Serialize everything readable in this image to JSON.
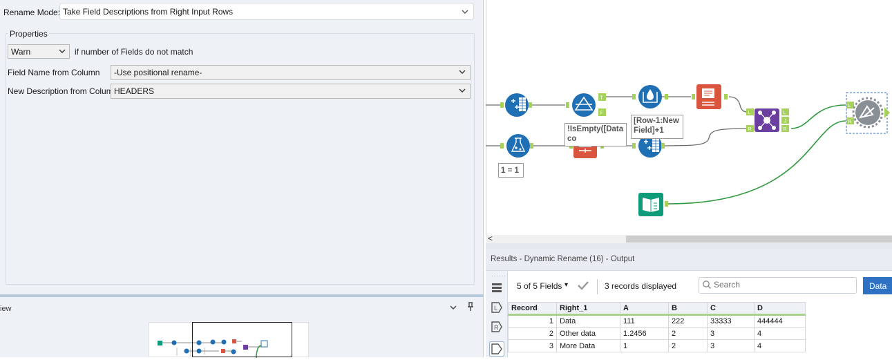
{
  "config": {
    "rename_mode_label": "Rename Mode:",
    "rename_mode_value": "Take Field Descriptions from Right Input Rows",
    "properties_label": "Properties",
    "warn_value": "Warn",
    "warn_suffix": "if number of Fields do not match",
    "field_name_label": "Field Name from Column",
    "field_name_value": "-Use positional rename-",
    "new_desc_label": "New Description from Column",
    "new_desc_value": "HEADERS"
  },
  "overview": {
    "title": "iew"
  },
  "canvas": {
    "annotations": {
      "filter": "!IsEmpty([Data co",
      "formula": "[Row-1:New Field]+1",
      "generate_rows": "1 = 1"
    },
    "anchors": {
      "true": "T",
      "false": "F",
      "left": "L",
      "right": "R",
      "join": "J"
    },
    "scroll_left_glyph": "<"
  },
  "results": {
    "title": "Results - Dynamic Rename (16) - Output",
    "fields_count": "5 of 5 Fields",
    "records_displayed": "3 records displayed",
    "search_placeholder": "Search",
    "data_button": "Data",
    "columns": [
      "Record",
      "Right_1",
      "A",
      "B",
      "C",
      "D"
    ],
    "rows": [
      [
        "1",
        "Data",
        "111",
        "222",
        "33333",
        "444444"
      ],
      [
        "2",
        "Other data",
        "1.2456",
        "2",
        "3",
        "4"
      ],
      [
        "3",
        "More Data",
        "1",
        "2",
        "3",
        "4"
      ]
    ]
  },
  "colors": {
    "accent_blue": "#2f72c4",
    "tool_blue": "#1f6fb5",
    "tool_orange": "#d9553d",
    "tool_purple": "#6b3fa0",
    "tool_green": "#0f9b7a",
    "tool_grey": "#8a8f96",
    "anchor_green": "#a6d25c",
    "connector_green": "#2f9a3e",
    "connector_grey": "#6d6d6d"
  }
}
